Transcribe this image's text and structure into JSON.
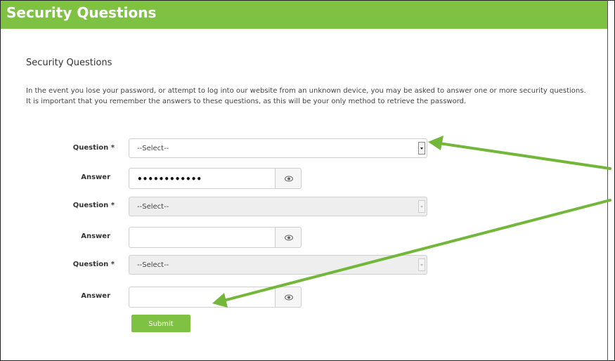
{
  "header": {
    "title": "Security Questions"
  },
  "section": {
    "title": "Security Questions",
    "intro": "In the event you lose your password, or attempt to log into our website from an unknown device, you may be asked to answer one or more security questions. It is important that you remember the answers to these questions, as this will be your only method to retrieve the password."
  },
  "form": {
    "question_label": "Question *",
    "answer_label": "Answer",
    "rows": [
      {
        "select_value": "--Select--",
        "answer_value": "••••••••••••",
        "enabled": true
      },
      {
        "select_value": "--Select--",
        "answer_value": "",
        "enabled": false
      },
      {
        "select_value": "--Select--",
        "answer_value": "",
        "enabled": false
      }
    ],
    "submit_label": "Submit"
  },
  "colors": {
    "accent": "#7fc142",
    "arrow": "#72b73a"
  },
  "icons": {
    "password_toggle": "eye-icon",
    "dropdown": "chevron-down-icon",
    "annotation": "arrow-icon"
  }
}
